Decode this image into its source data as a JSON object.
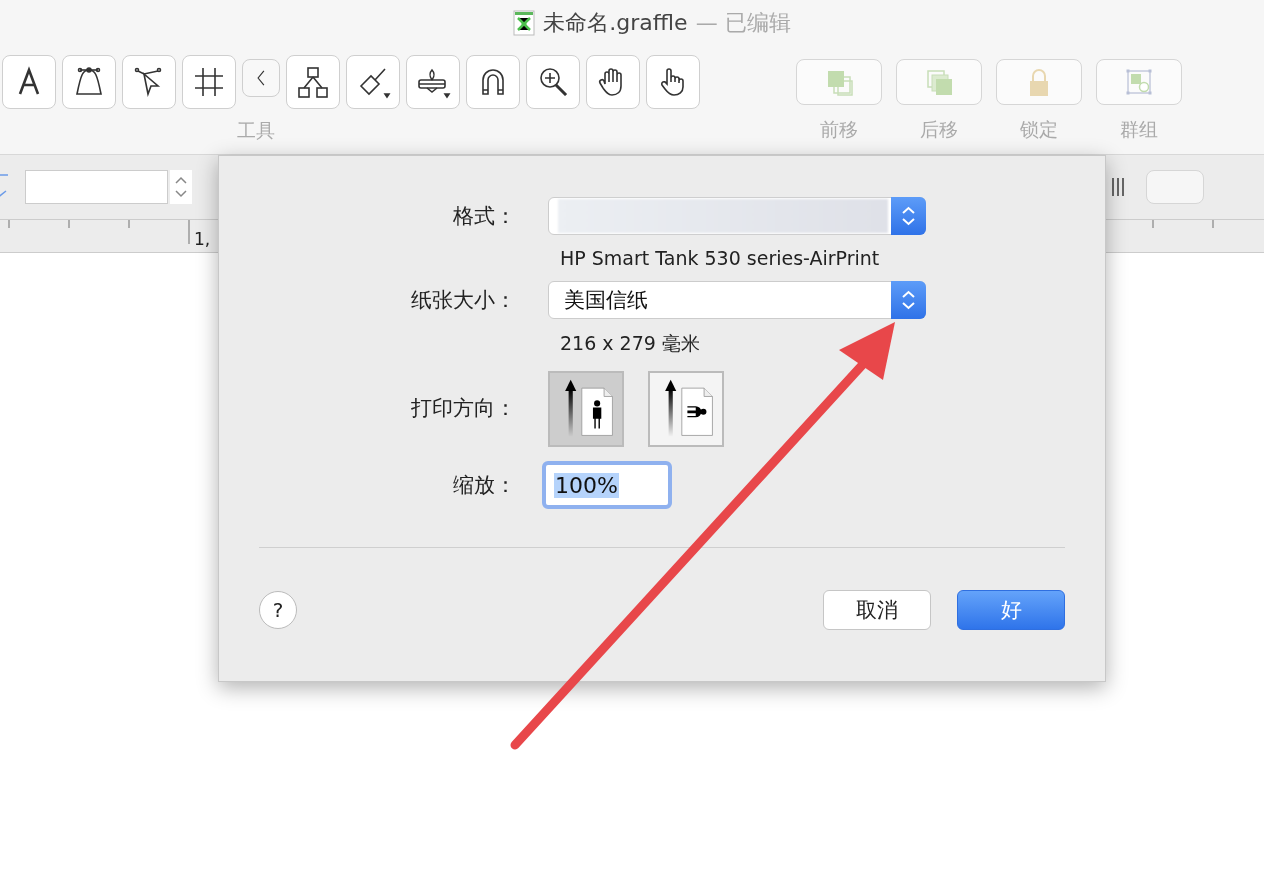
{
  "window": {
    "title": "未命名.graffle",
    "status": "— 已编辑"
  },
  "toolbar": {
    "tools": [
      {
        "kind": "text"
      },
      {
        "kind": "shape"
      },
      {
        "kind": "pen"
      },
      {
        "kind": "grid"
      },
      {
        "kind": "collapse"
      },
      {
        "kind": "diagram"
      },
      {
        "kind": "brush"
      },
      {
        "kind": "stamp"
      },
      {
        "kind": "magnet"
      },
      {
        "kind": "zoom"
      },
      {
        "kind": "hand"
      },
      {
        "kind": "pointer"
      }
    ],
    "tools_label": "工具",
    "actions": [
      {
        "kind": "front",
        "label": "前移"
      },
      {
        "kind": "back",
        "label": "后移"
      },
      {
        "kind": "lock",
        "label": "锁定"
      },
      {
        "kind": "group",
        "label": "群组"
      }
    ]
  },
  "ruler": {
    "label": "1,"
  },
  "dialog": {
    "format_label": "格式：",
    "printer": "HP Smart Tank 530 series-AirPrint",
    "paper_label": "纸张大小：",
    "paper": "美国信纸",
    "paper_dims": "216 x 279 毫米",
    "orientation_label": "打印方向：",
    "orientations": [
      {
        "kind": "portrait",
        "selected": true
      },
      {
        "kind": "landscape",
        "selected": false
      }
    ],
    "scale_label": "缩放：",
    "scale": "100%",
    "scale_text_selected": true,
    "help": "?",
    "cancel": "取消",
    "ok": "好"
  }
}
